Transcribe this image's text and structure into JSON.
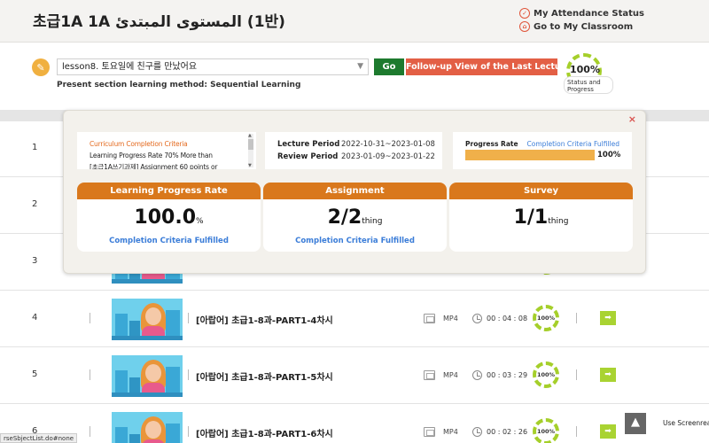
{
  "header": {
    "course_title": "초급1A 1A المستوى المبتدئ (1반)",
    "attendance_link": "My Attendance Status",
    "classroom_link": "Go to My Classroom",
    "accent_color": "#e0553a"
  },
  "lesson_bar": {
    "selected_lesson": "lesson8. 토요일에 친구를 만났어요",
    "go_label": "Go",
    "followup_label": "Follow-up View of the Last Lecture",
    "method_text": "Present section learning method: Sequential Learning",
    "progress_percent": "100%",
    "progress_label": "Status and Progress"
  },
  "popup": {
    "close_label": "×",
    "criteria_title": "Curriculum Completion Criteria",
    "criteria_line1": "Learning Progress Rate 70% More than",
    "criteria_line2": "[초급1A쓰기과제] Assignment 60 points or",
    "lecture_period_label": "Lecture Period",
    "lecture_period_value": "2022-10-31~2023-01-08",
    "review_period_label": "Review Period",
    "review_period_value": "2023-01-09~2023-01-22",
    "progress_rate_label": "Progress Rate",
    "progress_rate_status": "Completion Criteria Fulfilled",
    "progress_rate_value": "100%",
    "progress_rate_fraction": 1.0,
    "cards": [
      {
        "title": "Learning Progress Rate",
        "value": "100.0",
        "unit": "%",
        "status": "Completion Criteria Fulfilled"
      },
      {
        "title": "Assignment",
        "value": "2/2",
        "unit": "thing",
        "status": "Completion Criteria Fulfilled"
      },
      {
        "title": "Survey",
        "value": "1/1",
        "unit": "thing",
        "status": ""
      }
    ]
  },
  "rows": [
    {
      "num": "1"
    },
    {
      "num": "2"
    },
    {
      "num": "3"
    },
    {
      "num": "4",
      "title": "[아랍어] 초급1-8과-PART1-4차시",
      "type": "MP4",
      "duration": "00 : 04 : 08",
      "progress": "100%"
    },
    {
      "num": "5",
      "title": "[아랍어] 초급1-8과-PART1-5차시",
      "type": "MP4",
      "duration": "00 : 03 : 29",
      "progress": "100%"
    },
    {
      "num": "6",
      "title": "[아랍어] 초급1-8과-PART1-6차시",
      "type": "MP4",
      "duration": "00 : 02 : 26",
      "progress": "100%"
    }
  ],
  "footer": {
    "status_url": "rseSbjectList.do#none",
    "scroll_top_icon": "arrow-up-icon",
    "reader_link": "Use Screenread"
  }
}
